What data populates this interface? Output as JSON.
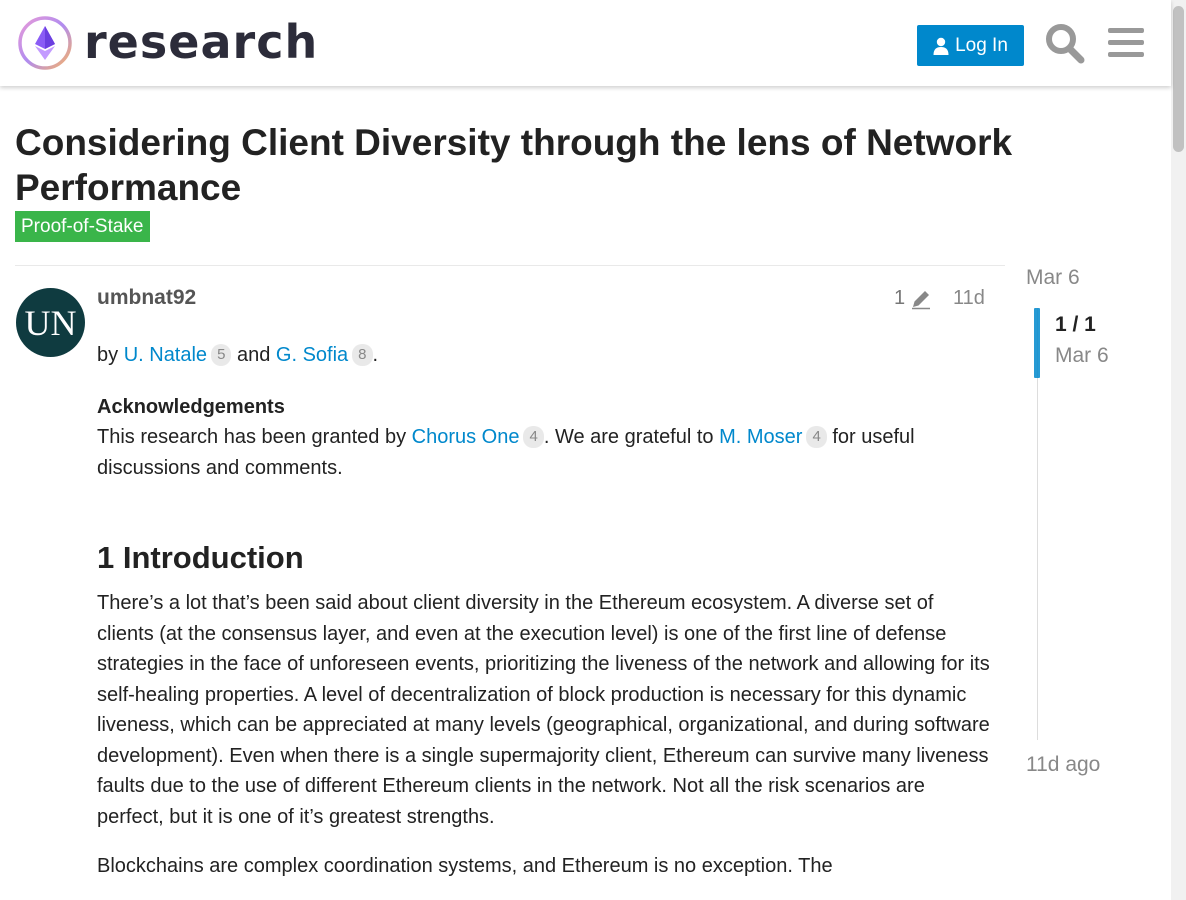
{
  "header": {
    "site_name": "research",
    "login_label": "Log In",
    "icons": [
      "ethereum-logo-icon",
      "user-icon",
      "search-icon",
      "hamburger-menu-icon"
    ]
  },
  "topic": {
    "title": "Considering Client Diversity through the lens of Network Performance",
    "category": "Proof-of-Stake",
    "category_color": "#3ab54a"
  },
  "post": {
    "avatar_text": "UN",
    "username": "umbnat92",
    "edit_count": "1",
    "age": "11d",
    "byline": {
      "by": "by",
      "author1": "U. Natale",
      "author1_badge": "5",
      "and": "and",
      "author2": "G. Sofia",
      "author2_badge": "8",
      "end": "."
    },
    "ack_heading": "Acknowledgements",
    "ack": {
      "part1": "This research has been granted by",
      "org": "Chorus One",
      "org_badge": "4",
      "part2": ". We are grateful to",
      "person": "M. Moser",
      "person_badge": "4",
      "part3": "for useful discussions and comments."
    },
    "section_heading": "1 Introduction",
    "intro_p1": "There’s a lot that’s been said about client diversity in the Ethereum ecosystem. A diverse set of clients (at the consensus layer, and even at the execution level) is one of the first line of defense strategies in the face of unforeseen events, prioritizing the liveness of the network and allowing for its self-healing properties. A level of decentralization of block production is necessary for this dynamic liveness, which can be appreciated at many levels (geographical, organizational, and during software development). Even when there is a single supermajority client, Ethereum can survive many liveness faults due to the use of different Ethereum clients in the network. Not all the risk scenarios are perfect, but it is one of it’s greatest strengths.",
    "intro_p2": "Blockchains are complex coordination systems, and Ethereum is no exception. The"
  },
  "timeline": {
    "start_date": "Mar 6",
    "position": "1 / 1",
    "current_date": "Mar 6",
    "end_label": "11d ago",
    "accent": "#0088cc"
  },
  "colors": {
    "link": "#0088cc",
    "button": "#0088cc"
  }
}
